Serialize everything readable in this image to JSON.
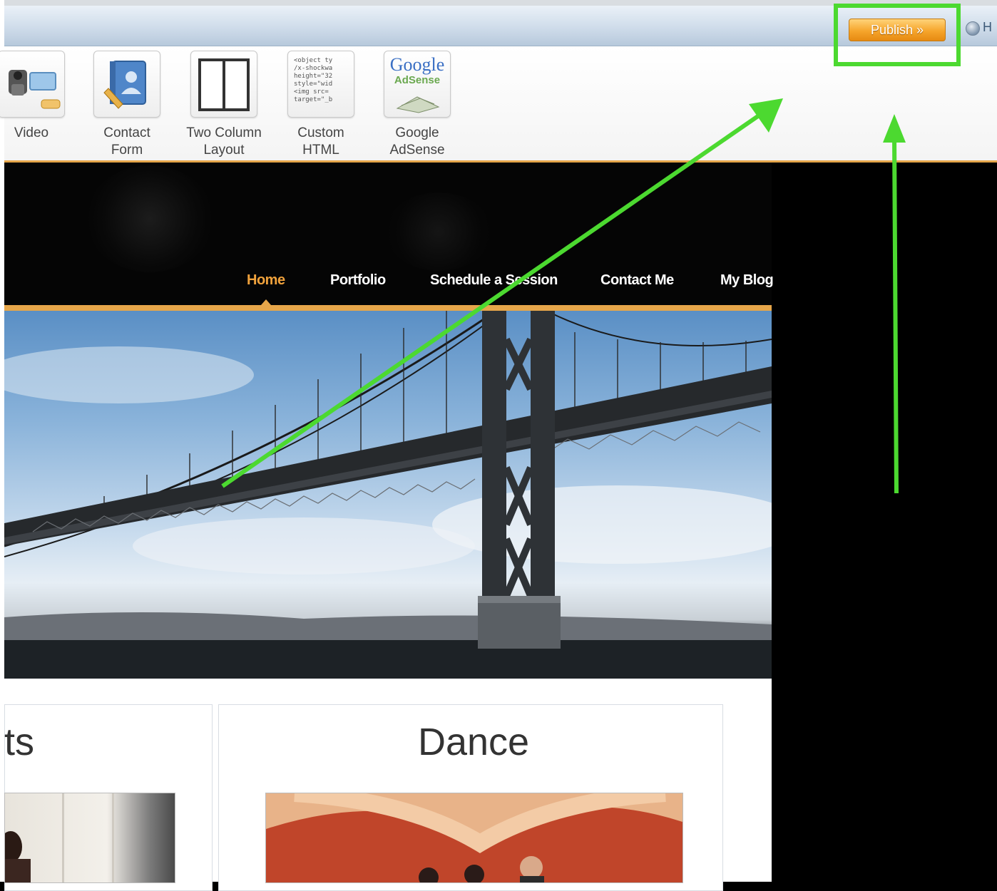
{
  "topbar": {
    "publish_label": "Publish »",
    "help_text": "H"
  },
  "toolbar": {
    "items": [
      {
        "label": "Video",
        "icon": "video-camera-icon"
      },
      {
        "label": "Contact\nForm",
        "icon": "contact-form-icon"
      },
      {
        "label": "Two Column\nLayout",
        "icon": "two-column-layout-icon"
      },
      {
        "label": "Custom\nHTML",
        "icon": "custom-html-icon"
      },
      {
        "label": "Google\nAdSense",
        "icon": "google-adsense-icon"
      }
    ],
    "html_snippet": "<object ty\n/x-shockwa\nheight=\"32\nstyle=\"wid\n<img src=\ntarget=\"_b",
    "adsense_logo_top": "Google",
    "adsense_logo_bottom": "AdSense"
  },
  "nav": {
    "items": [
      "Home",
      "Portfolio",
      "Schedule a Session",
      "Contact Me",
      "My Blog"
    ],
    "active": "Home"
  },
  "cards": [
    {
      "title": "ts"
    },
    {
      "title": "Dance"
    }
  ],
  "colors": {
    "accent_orange": "#e6a64a",
    "annotation_green": "#4cd930",
    "page_background": "#000000"
  }
}
